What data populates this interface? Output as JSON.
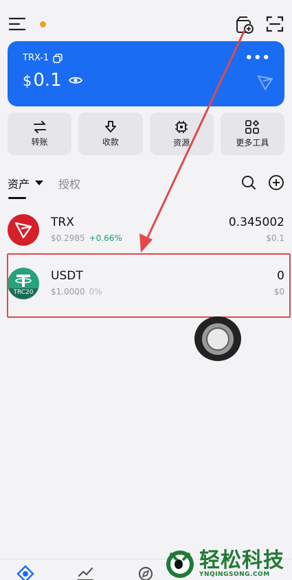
{
  "header": {
    "menu_icon": "hamburger-icon",
    "dot_color": "#f0a020"
  },
  "wallet": {
    "account_name": "TRX-1",
    "currency_symbol": "$",
    "balance": "0.1",
    "more_label": "•••",
    "color": "#1a6cf2"
  },
  "actions": [
    {
      "label": "转账",
      "icon": "transfer-icon"
    },
    {
      "label": "收款",
      "icon": "receive-icon"
    },
    {
      "label": "资源",
      "icon": "chip-icon"
    },
    {
      "label": "更多工具",
      "icon": "grid-icon"
    }
  ],
  "tabs": {
    "assets": "资产",
    "authorize": "授权"
  },
  "tokens": [
    {
      "symbol": "TRX",
      "price": "$0.2985",
      "change": "+0.66%",
      "amount": "0.345002",
      "value": "$0.1",
      "change_color": "#1aa06a"
    },
    {
      "symbol": "USDT",
      "price": "$1.0000",
      "change": "0%",
      "amount": "0",
      "value": "$0",
      "badge": "TRC20",
      "change_color": "#bbbbbb"
    }
  ],
  "annotation_color": "#e04a4a",
  "watermark": {
    "title": "轻松科技",
    "subtitle": "YNQINGSONG.COM"
  }
}
